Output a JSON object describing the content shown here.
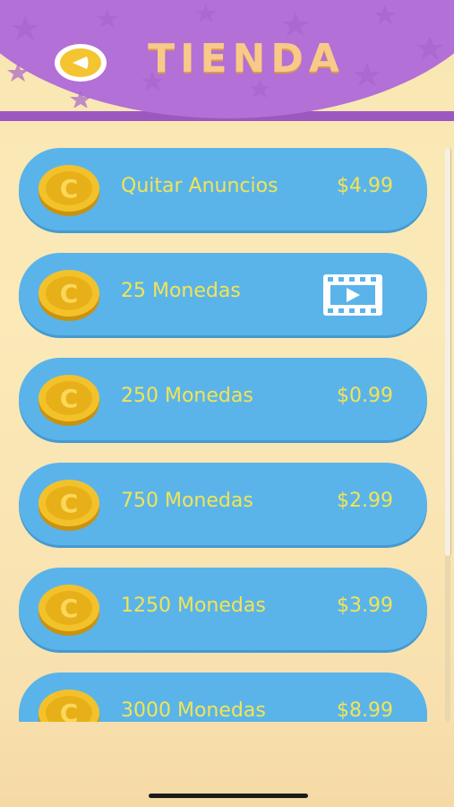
{
  "header": {
    "title": "TIENDA",
    "back_icon": "back-arrow-icon",
    "colors": {
      "header_bg": "#b370d6",
      "title": "#f9c98a"
    }
  },
  "shop": {
    "colors": {
      "item_bg": "#5ab4ea",
      "item_text": "#f3e454"
    },
    "items": [
      {
        "label": "Quitar Anuncios",
        "price": "$4.99",
        "icon": "coin-icon"
      },
      {
        "label": "25 Monedas",
        "price": "",
        "icon": "coin-icon",
        "action_icon": "video-ad-icon"
      },
      {
        "label": "250 Monedas",
        "price": "$0.99",
        "icon": "coin-icon"
      },
      {
        "label": "750 Monedas",
        "price": "$2.99",
        "icon": "coin-icon"
      },
      {
        "label": "1250 Monedas",
        "price": "$3.99",
        "icon": "coin-icon"
      },
      {
        "label": "3000 Monedas",
        "price": "$8.99",
        "icon": "coin-icon"
      }
    ]
  }
}
